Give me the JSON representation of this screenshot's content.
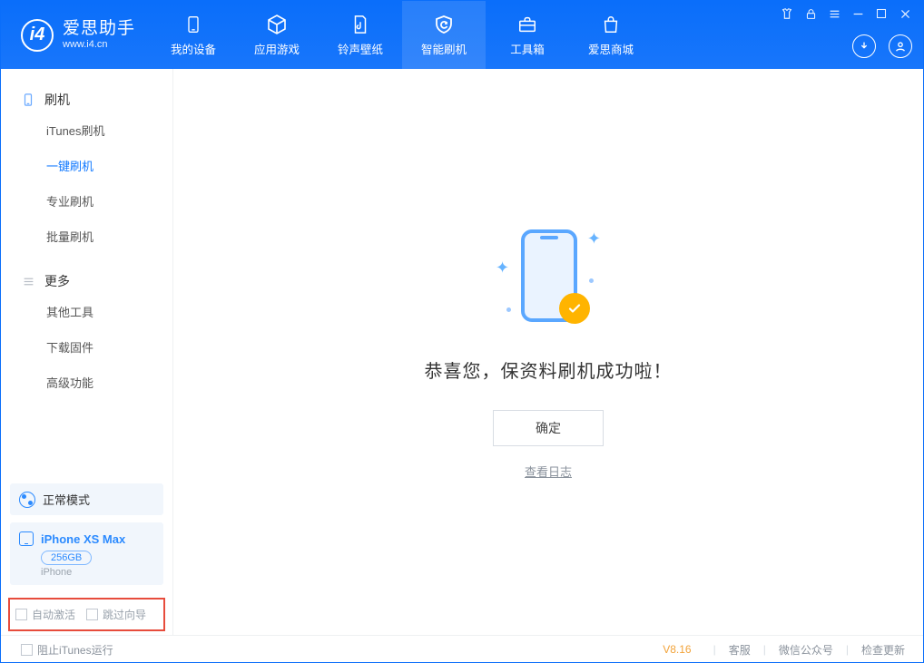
{
  "app": {
    "name_cn": "爱思助手",
    "url": "www.i4.cn"
  },
  "nav": {
    "my_device": "我的设备",
    "apps_games": "应用游戏",
    "ring_wall": "铃声壁纸",
    "smart_flash": "智能刷机",
    "toolbox": "工具箱",
    "store": "爱思商城"
  },
  "sidebar": {
    "group_flash": "刷机",
    "items": {
      "itunes": "iTunes刷机",
      "oneclick": "一键刷机",
      "pro": "专业刷机",
      "batch": "批量刷机"
    },
    "group_more": "更多",
    "more": {
      "other": "其他工具",
      "firmware": "下载固件",
      "advanced": "高级功能"
    }
  },
  "device": {
    "mode": "正常模式",
    "name": "iPhone XS Max",
    "capacity": "256GB",
    "type": "iPhone"
  },
  "options": {
    "auto_activate": "自动激活",
    "skip_guide": "跳过向导"
  },
  "main": {
    "success_msg": "恭喜您，保资料刷机成功啦！",
    "ok": "确定",
    "view_log": "查看日志"
  },
  "footer": {
    "block_itunes": "阻止iTunes运行",
    "version": "V8.16",
    "support": "客服",
    "wechat": "微信公众号",
    "check_update": "检查更新"
  }
}
